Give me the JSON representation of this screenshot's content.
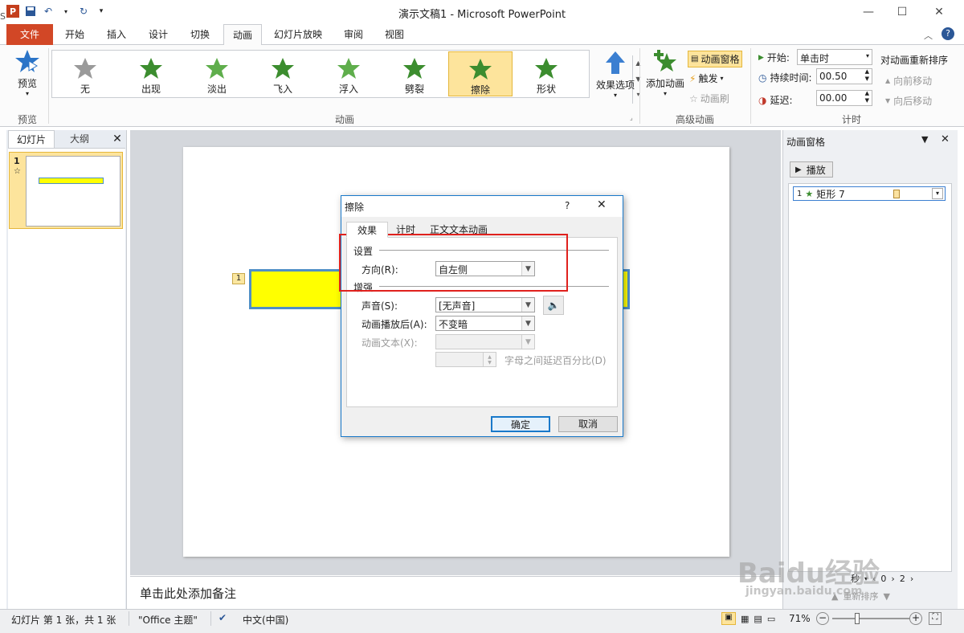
{
  "app": {
    "title": "演示文稿1 - Microsoft PowerPoint",
    "left_edge_letter": "S"
  },
  "tabs": [
    "文件",
    "开始",
    "插入",
    "设计",
    "切换",
    "动画",
    "幻灯片放映",
    "审阅",
    "视图"
  ],
  "ribbon": {
    "preview": {
      "label": "预览",
      "group": "预览"
    },
    "effects": [
      {
        "label": "无",
        "icon": "star-gray-icon"
      },
      {
        "label": "出现",
        "icon": "star-green-icon"
      },
      {
        "label": "淡出",
        "icon": "star-green-light-icon"
      },
      {
        "label": "飞入",
        "icon": "star-green-flyin-icon"
      },
      {
        "label": "浮入",
        "icon": "star-green-float-icon"
      },
      {
        "label": "劈裂",
        "icon": "star-green-split-icon"
      },
      {
        "label": "擦除",
        "icon": "star-green-wipe-icon",
        "selected": true
      },
      {
        "label": "形状",
        "icon": "star-green-shape-icon"
      }
    ],
    "effect_options": "效果选项",
    "animation_group": "动画",
    "add_animation": "添加动画",
    "animation_pane": "动画窗格",
    "trigger": "触发",
    "painter": "动画刷",
    "advanced_group": "高级动画",
    "start_label": "开始:",
    "start_value": "单击时",
    "duration_label": "持续时间:",
    "duration_value": "00.50",
    "delay_label": "延迟:",
    "delay_value": "00.00",
    "timing_group": "计时",
    "reorder_title": "对动画重新排序",
    "move_earlier": "向前移动",
    "move_later": "向后移动"
  },
  "left_panel": {
    "tab_slides": "幻灯片",
    "tab_outline": "大纲",
    "slide_number": "1",
    "slide_marker": "☆"
  },
  "notes_placeholder": "单击此处添加备注",
  "slide": {
    "anim_tag": "1"
  },
  "anim_pane": {
    "title": "动画窗格",
    "play": "播放",
    "item": {
      "index": "1",
      "name": "矩形 7"
    },
    "seconds_label": "秒",
    "page_1": "0",
    "page_2": "2",
    "reorder": "重新排序"
  },
  "statusbar": {
    "slide_info": "幻灯片 第 1 张，共 1 张",
    "theme": "\"Office 主题\"",
    "language": "中文(中国)",
    "zoom": "71%"
  },
  "dialog": {
    "title": "擦除",
    "help": "?",
    "tabs": [
      "效果",
      "计时",
      "正文文本动画"
    ],
    "settings_header": "设置",
    "direction_label": "方向(R):",
    "direction_value": "自左侧",
    "enhance_header": "增强",
    "sound_label": "声音(S):",
    "sound_value": "[无声音]",
    "after_label": "动画播放后(A):",
    "after_value": "不变暗",
    "text_label": "动画文本(X):",
    "text_value": "",
    "delay_pct_label": "字母之间延迟百分比(D)",
    "ok": "确定",
    "cancel": "取消"
  },
  "watermark": {
    "brand": "Baidu经验",
    "url": "jingyan.baidu.com"
  },
  "colors": {
    "accent_file": "#d24726",
    "selected_effect": "#fde49c",
    "shape_fill": "#ffff00",
    "shape_border": "#4f8fc6",
    "highlight": "#e0211d",
    "dialog_border": "#1979ca"
  }
}
